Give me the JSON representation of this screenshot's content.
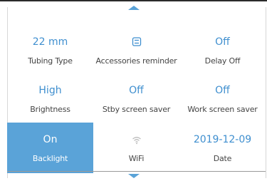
{
  "settings": [
    {
      "value": "22 mm",
      "label": "Tubing Type"
    },
    {
      "value": "",
      "icon": "accessories-icon",
      "label": "Accessories reminder"
    },
    {
      "value": "Off",
      "label": "Delay Off"
    },
    {
      "value": "High",
      "label": "Brightness"
    },
    {
      "value": "Off",
      "label": "Stby screen saver"
    },
    {
      "value": "Off",
      "label": "Work screen saver"
    },
    {
      "value": "On",
      "label": "Backlight",
      "selected": true
    },
    {
      "value": "",
      "icon": "wifi-icon",
      "label": "WiFi"
    },
    {
      "value": "2019-12-09",
      "label": "Date"
    }
  ],
  "colors": {
    "accent": "#3f8fcf",
    "selected_bg": "#5aa3d8",
    "label": "#444444"
  }
}
